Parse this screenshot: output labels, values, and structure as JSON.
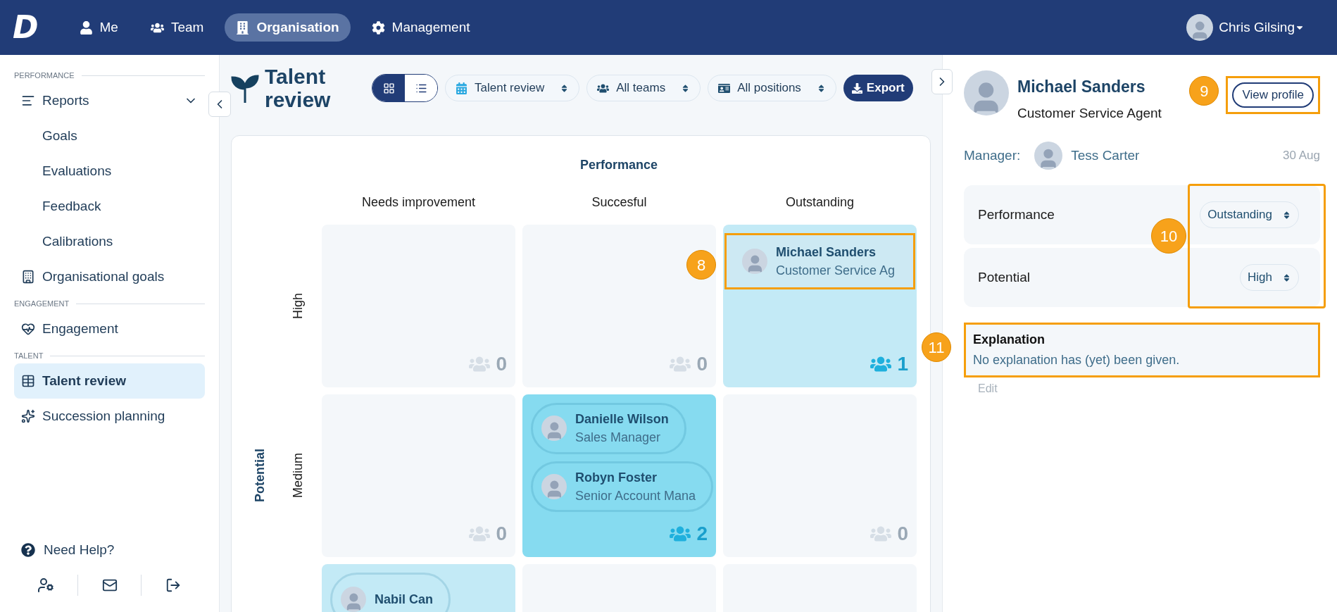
{
  "topbar": {
    "logo": "D",
    "nav": [
      {
        "label": "Me",
        "selected": false
      },
      {
        "label": "Team",
        "selected": false
      },
      {
        "label": "Organisation",
        "selected": true
      },
      {
        "label": "Management",
        "selected": false
      }
    ],
    "user": {
      "name": "Chris Gilsing"
    }
  },
  "sidebar": {
    "sections": [
      {
        "heading": "PERFORMANCE",
        "items": [
          {
            "label": "Reports",
            "selected": false,
            "expanded": true,
            "children": [
              {
                "label": "Goals",
                "selected": false
              },
              {
                "label": "Evaluations",
                "selected": false
              },
              {
                "label": "Feedback",
                "selected": false
              },
              {
                "label": "Calibrations",
                "selected": false
              }
            ]
          },
          {
            "label": "Organisational goals",
            "selected": false
          }
        ]
      },
      {
        "heading": "ENGAGEMENT",
        "items": [
          {
            "label": "Engagement",
            "selected": false
          }
        ]
      },
      {
        "heading": "TALENT",
        "items": [
          {
            "label": "Talent review",
            "selected": true
          },
          {
            "label": "Succession planning",
            "selected": false
          }
        ]
      }
    ],
    "help": "Need Help?"
  },
  "toolbar": {
    "title": "Talent review",
    "views": [
      {
        "kind": "grid",
        "selected": true
      },
      {
        "kind": "list",
        "selected": false
      }
    ],
    "filters": [
      {
        "kind": "calendar",
        "label": "Talent review"
      },
      {
        "kind": "teams",
        "label": "All teams"
      },
      {
        "kind": "positions",
        "label": "All positions"
      }
    ],
    "export": "Export"
  },
  "matrix": {
    "x_title": "Performance",
    "y_title": "Potential",
    "columns": [
      "Needs improvement",
      "Succesful",
      "Outstanding"
    ],
    "rows": [
      {
        "label": "High",
        "cells": [
          {
            "color": "#f4f7fa",
            "count": "0"
          },
          {
            "color": "#f4f7fa",
            "count": "0"
          },
          {
            "color": "#c3eaf6",
            "count": "1",
            "people": [
              {
                "name": "Michael Sanders",
                "role": "Customer Service Ag",
                "callout": "8"
              }
            ]
          }
        ]
      },
      {
        "label": "Medium",
        "cells": [
          {
            "color": "#f4f7fa",
            "count": "0"
          },
          {
            "color": "#86dbf0",
            "count": "2",
            "people": [
              {
                "name": "Danielle Wilson",
                "role": "Sales Manager"
              },
              {
                "name": "Robyn Foster",
                "role": "Senior Account Mana"
              }
            ]
          },
          {
            "color": "#f4f7fa",
            "count": "0"
          }
        ]
      },
      {
        "cells": [
          {
            "color": "#c3eaf6",
            "people": [
              {
                "name": "Nabil Can"
              }
            ]
          },
          {
            "color": "#f4f7fa"
          },
          {
            "color": "#f4f7fa"
          }
        ]
      }
    ]
  },
  "panel": {
    "name": "Michael Sanders",
    "role": "Customer Service Agent",
    "view_profile": {
      "label": "View profile",
      "callout": "9"
    },
    "manager_label": "Manager:",
    "manager": "Tess Carter",
    "date": "30 Aug",
    "ratings": {
      "callout": "10",
      "items": [
        {
          "label": "Performance",
          "value": "Outstanding"
        },
        {
          "label": "Potential",
          "value": "High"
        }
      ]
    },
    "explanation": {
      "title": "Explanation",
      "text": "No explanation has (yet) been given.",
      "callout": "11"
    },
    "edit": "Edit"
  }
}
